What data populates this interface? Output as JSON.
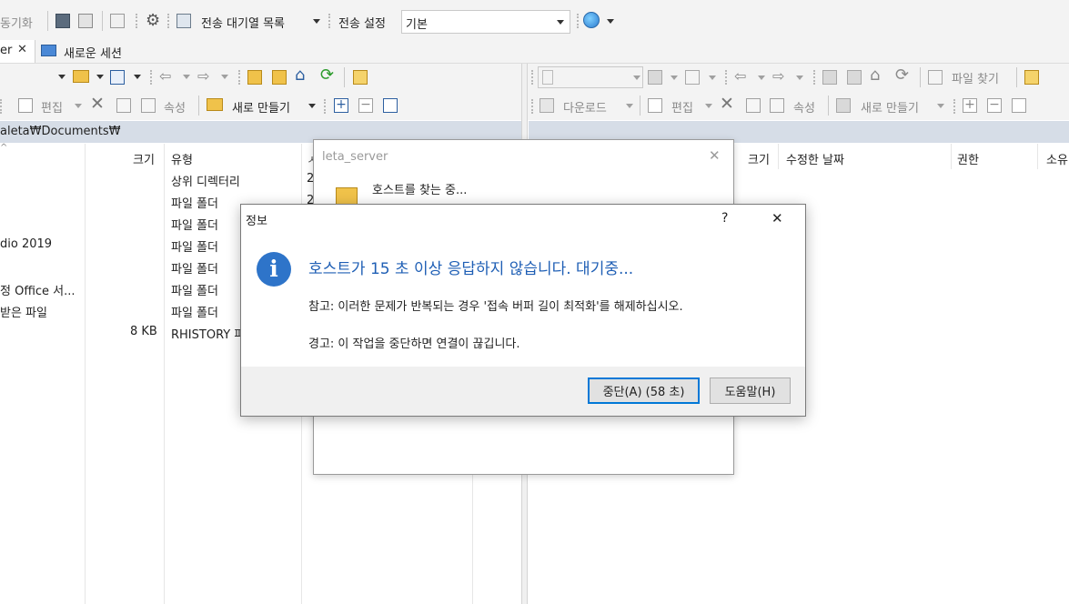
{
  "toolbar1": {
    "sync_browse": "동기화",
    "queue_label": "전송 대기열 목록",
    "transfer_settings_label": "전송 설정",
    "transfer_settings_value": "기본"
  },
  "tabs": [
    {
      "label": "er"
    },
    {
      "label": "새로운 세션"
    }
  ],
  "left_panel": {
    "toolbar_edit": "편집",
    "toolbar_properties": "속성",
    "toolbar_new": "새로 만들기",
    "path": "aleta₩Documents₩",
    "columns": {
      "size": "크기",
      "type": "유형"
    },
    "rows": [
      {
        "name": "",
        "size": "",
        "type": "상위 디렉터리",
        "changed": "2"
      },
      {
        "name": "",
        "size": "",
        "type": "파일 폴더",
        "changed": "2"
      },
      {
        "name": "",
        "size": "",
        "type": "파일 폴더",
        "changed": ""
      },
      {
        "name": "dio 2019",
        "size": "",
        "type": "파일 폴더",
        "changed": ""
      },
      {
        "name": "",
        "size": "",
        "type": "파일 폴더",
        "changed": ""
      },
      {
        "name": "정 Office 서...",
        "size": "",
        "type": "파일 폴더",
        "changed": ""
      },
      {
        "name": "받은 파일",
        "size": "",
        "type": "파일 폴더",
        "changed": ""
      },
      {
        "name": "",
        "size": "8 KB",
        "type": "RHISTORY 파",
        "changed": ""
      }
    ]
  },
  "right_panel": {
    "find_files": "파일 찾기",
    "download": "다운로드",
    "edit": "편집",
    "properties": "속성",
    "new": "새로 만들기",
    "columns": {
      "size": "크기",
      "changed": "수정한 날짜",
      "rights": "권한",
      "owner": "소유"
    }
  },
  "back_dialog": {
    "title": "leta_server",
    "status": "호스트를 찾는 중..."
  },
  "dialog": {
    "title": "정보",
    "help_glyph": "?",
    "close_glyph": "✕",
    "heading": "호스트가 15 초 이상 응답하지 않습니다. 대기중...",
    "note": "참고: 이러한 문제가 반복되는 경우 '접속 버퍼 길이 최적화'를 해제하십시오.",
    "warning": "경고: 이 작업을 중단하면 연결이 끊깁니다.",
    "abort_button": "중단(A) (58 초)",
    "help_button": "도움말(H)"
  },
  "colors": {
    "toolbar_bg": "#f3f3f3",
    "path_bar_bg": "#d6dde7",
    "heading_blue": "#1f5fb5",
    "info_icon_blue": "#2e74c9",
    "primary_border": "#0078d7"
  }
}
